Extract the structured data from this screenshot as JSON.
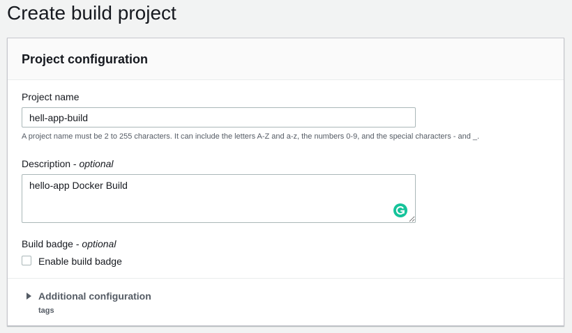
{
  "page": {
    "title": "Create build project"
  },
  "panel": {
    "title": "Project configuration"
  },
  "project_name": {
    "label": "Project name",
    "value": "hell-app-build",
    "hint": "A project name must be 2 to 255 characters. It can include the letters A-Z and a-z, the numbers 0-9, and the special characters - and _."
  },
  "description": {
    "label": "Description",
    "optional": "optional",
    "separator": " - ",
    "value": "hello-app Docker Build"
  },
  "build_badge": {
    "label": "Build badge",
    "optional": "optional",
    "separator": " - ",
    "checkbox_label": "Enable build badge",
    "checked": false
  },
  "additional_configuration": {
    "label": "Additional configuration",
    "subtitle": "tags"
  },
  "icons": {
    "grammarly": "grammarly-icon",
    "expand": "caret-right-icon"
  },
  "colors": {
    "background": "#f2f3f3",
    "panel": "#ffffff",
    "grammarly": "#15c39a"
  }
}
